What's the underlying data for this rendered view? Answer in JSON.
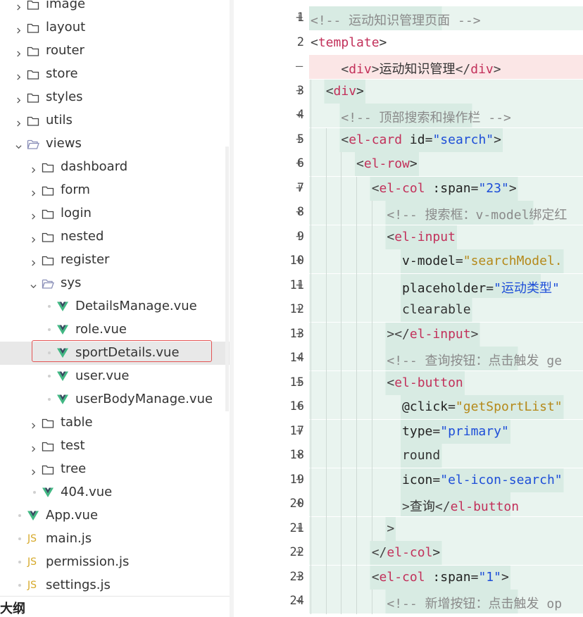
{
  "tree": {
    "items": [
      {
        "kind": "folder",
        "open": false,
        "label": "image"
      },
      {
        "kind": "folder",
        "open": false,
        "label": "layout"
      },
      {
        "kind": "folder",
        "open": false,
        "label": "router"
      },
      {
        "kind": "folder",
        "open": false,
        "label": "store"
      },
      {
        "kind": "folder",
        "open": false,
        "label": "styles"
      },
      {
        "kind": "folder",
        "open": false,
        "label": "utils"
      },
      {
        "kind": "folder",
        "open": true,
        "label": "views"
      },
      {
        "kind": "folder",
        "open": false,
        "label": "dashboard"
      },
      {
        "kind": "folder",
        "open": false,
        "label": "form"
      },
      {
        "kind": "folder",
        "open": false,
        "label": "login"
      },
      {
        "kind": "folder",
        "open": false,
        "label": "nested"
      },
      {
        "kind": "folder",
        "open": false,
        "label": "register"
      },
      {
        "kind": "folder",
        "open": true,
        "label": "sys"
      },
      {
        "kind": "vue",
        "label": "DetailsManage.vue"
      },
      {
        "kind": "vue",
        "label": "role.vue"
      },
      {
        "kind": "vue",
        "label": "sportDetails.vue",
        "selected": true
      },
      {
        "kind": "vue",
        "label": "user.vue"
      },
      {
        "kind": "vue",
        "label": "userBodyManage.vue"
      },
      {
        "kind": "folder",
        "open": false,
        "label": "table"
      },
      {
        "kind": "folder",
        "open": false,
        "label": "test"
      },
      {
        "kind": "folder",
        "open": false,
        "label": "tree"
      },
      {
        "kind": "vue",
        "label": "404.vue"
      },
      {
        "kind": "vue",
        "label": "App.vue"
      },
      {
        "kind": "js",
        "label": "main.js"
      },
      {
        "kind": "js",
        "label": "permission.js"
      },
      {
        "kind": "js",
        "label": "settings.js"
      }
    ],
    "js_badge": "JS",
    "outline_label": "大纲"
  },
  "editor": {
    "lines": [
      {
        "num": "1",
        "mark": "+",
        "type": "add",
        "text": "<!-- 运动知识管理页面 -->"
      },
      {
        "num": "2",
        "mark": "",
        "type": "ctx",
        "text": "<template>"
      },
      {
        "num": "",
        "mark": "—",
        "type": "del",
        "text": "    <div>运动知识管理</div>"
      },
      {
        "num": "3",
        "mark": "+",
        "type": "add",
        "text": "  <div>"
      },
      {
        "num": "4",
        "mark": "+",
        "type": "add",
        "text": "    <!-- 顶部搜索和操作栏 -->"
      },
      {
        "num": "5",
        "mark": "+",
        "type": "add",
        "text": "    <el-card id=\"search\">"
      },
      {
        "num": "6",
        "mark": "+",
        "type": "add",
        "text": "      <el-row>"
      },
      {
        "num": "7",
        "mark": "+",
        "type": "add",
        "text": "        <el-col :span=\"23\">"
      },
      {
        "num": "8",
        "mark": "+",
        "type": "add",
        "text": "          <!-- 搜索框：v-model绑定红"
      },
      {
        "num": "9",
        "mark": "+",
        "type": "add",
        "text": "          <el-input"
      },
      {
        "num": "10",
        "mark": "+",
        "type": "add",
        "text": "            v-model=\"searchModel."
      },
      {
        "num": "11",
        "mark": "+",
        "type": "add",
        "text": "            placeholder=\"运动类型\""
      },
      {
        "num": "12",
        "mark": "+",
        "type": "add",
        "text": "            clearable"
      },
      {
        "num": "13",
        "mark": "+",
        "type": "add",
        "text": "          ></el-input>"
      },
      {
        "num": "14",
        "mark": "+",
        "type": "add",
        "text": "          <!-- 查询按钮：点击触发 ge"
      },
      {
        "num": "15",
        "mark": "+",
        "type": "add",
        "text": "          <el-button"
      },
      {
        "num": "16",
        "mark": "+",
        "type": "add",
        "text": "            @click=\"getSportList\""
      },
      {
        "num": "17",
        "mark": "+",
        "type": "add",
        "text": "            type=\"primary\""
      },
      {
        "num": "18",
        "mark": "+",
        "type": "add",
        "text": "            round"
      },
      {
        "num": "19",
        "mark": "+",
        "type": "add",
        "text": "            icon=\"el-icon-search\""
      },
      {
        "num": "20",
        "mark": "+",
        "type": "add",
        "text": "            >查询</el-button"
      },
      {
        "num": "21",
        "mark": "+",
        "type": "add",
        "text": "          >"
      },
      {
        "num": "22",
        "mark": "+",
        "type": "add",
        "text": "        </el-col>"
      },
      {
        "num": "23",
        "mark": "+",
        "type": "add",
        "text": "        <el-col :span=\"1\">"
      },
      {
        "num": "24",
        "mark": "+",
        "type": "add",
        "text": "          <!-- 新增按钮：点击触发 op"
      }
    ]
  },
  "colors": {
    "added_bg": "#e6f3ee",
    "deleted_bg": "#fbe6e6",
    "tag": "#c2305a",
    "string": "#1d4ed8",
    "variable": "#b5891a",
    "comment": "#8a8a8a",
    "vue_icon": "#41b883",
    "selection_border": "#e45454"
  }
}
